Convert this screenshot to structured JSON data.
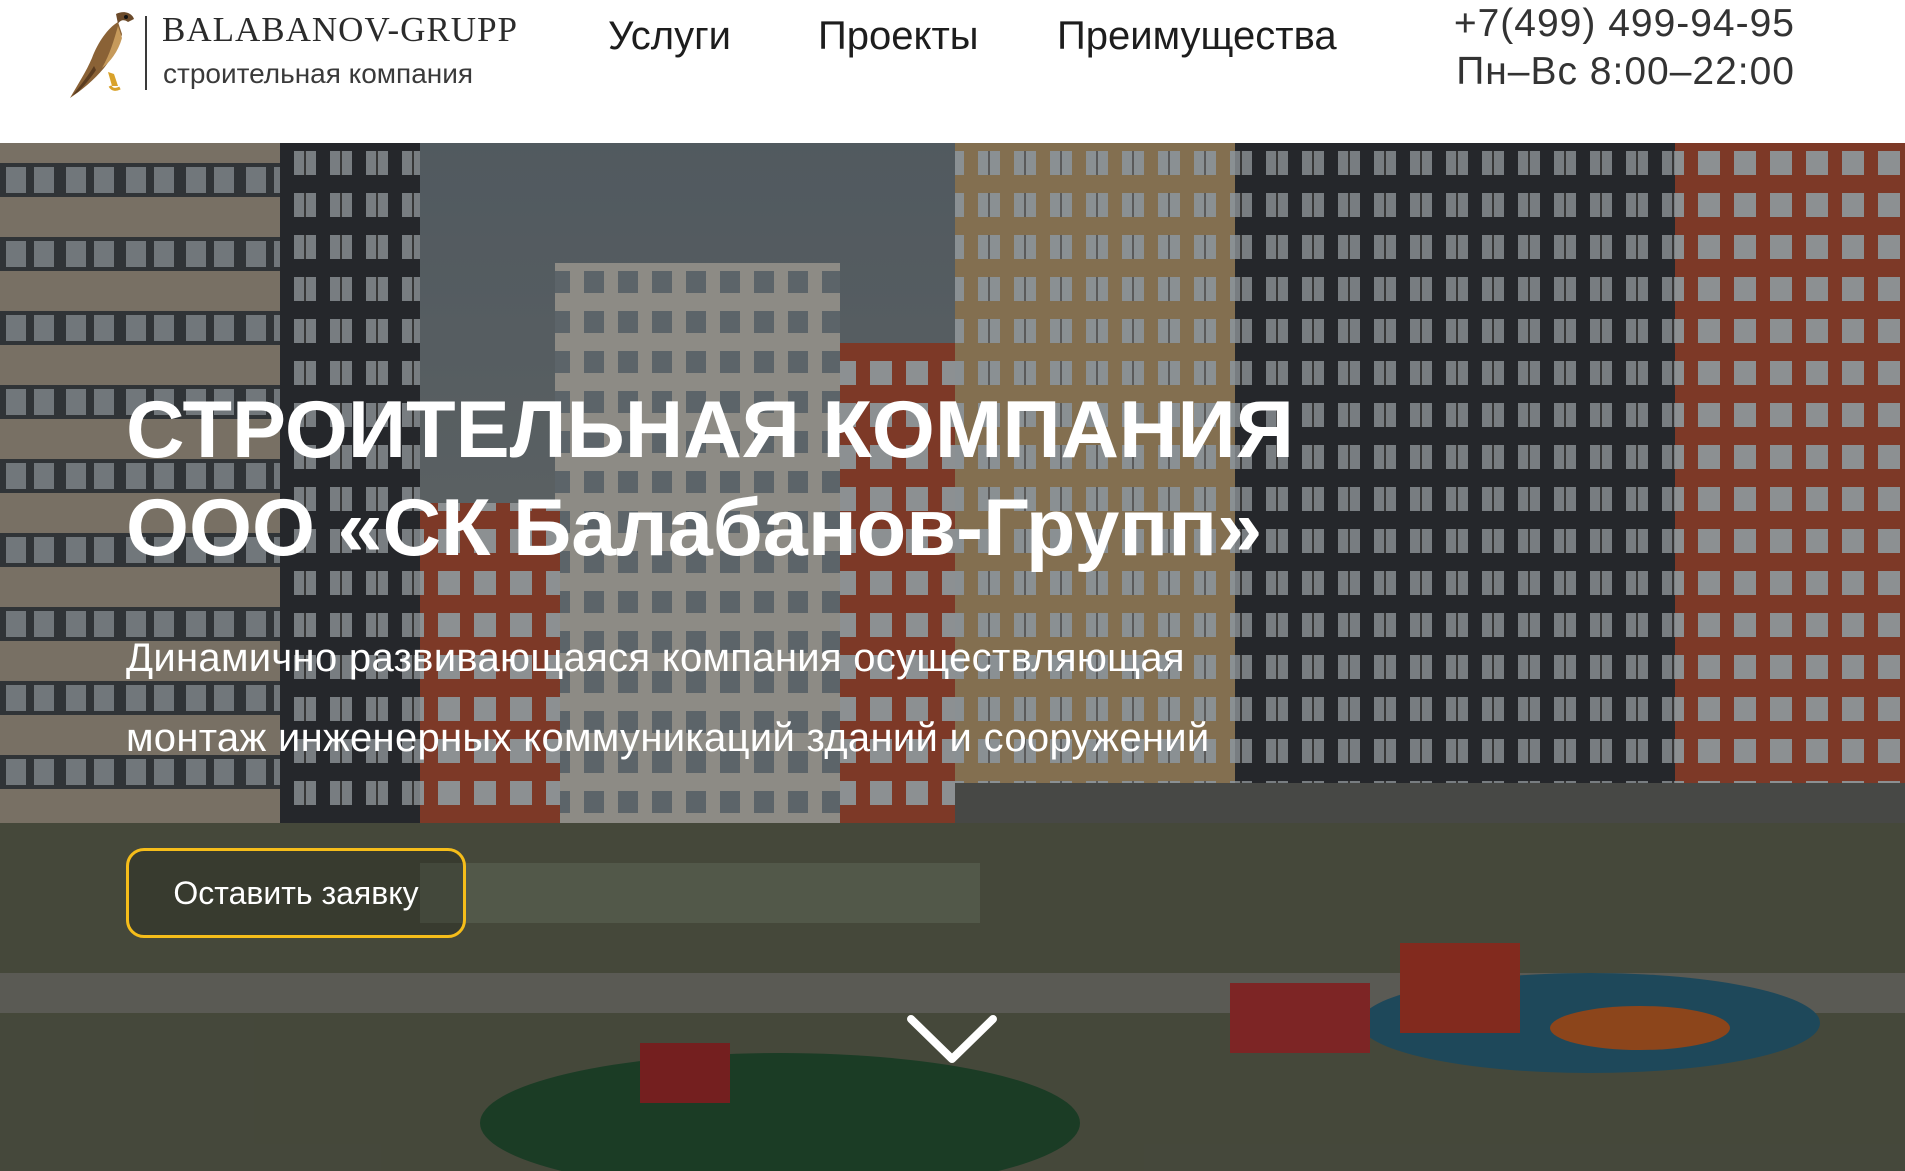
{
  "header": {
    "logo": {
      "name": "BALABANOV-GRUPP",
      "tagline": "строительная компания"
    },
    "nav": [
      {
        "label": "Услуги"
      },
      {
        "label": "Проекты"
      },
      {
        "label": "Преимущества"
      }
    ],
    "contact": {
      "phone": "+7(499) 499-94-95",
      "hours": "Пн–Вс 8:00–22:00"
    }
  },
  "hero": {
    "title_line1": "СТРОИТЕЛЬНАЯ КОМПАНИЯ",
    "title_line2": "ООО «СК Балабанов-Групп»",
    "subtitle_line1": "Динамично развивающаяся компания осуществляющая",
    "subtitle_line2": "монтаж инженерных коммуникаций зданий и сооружений",
    "cta_label": "Оставить заявку",
    "scroll_icon": "chevron-down-icon"
  },
  "colors": {
    "accent": "#f5bd1a",
    "text_dark": "#1d1d1d",
    "hero_text": "#ffffff"
  }
}
